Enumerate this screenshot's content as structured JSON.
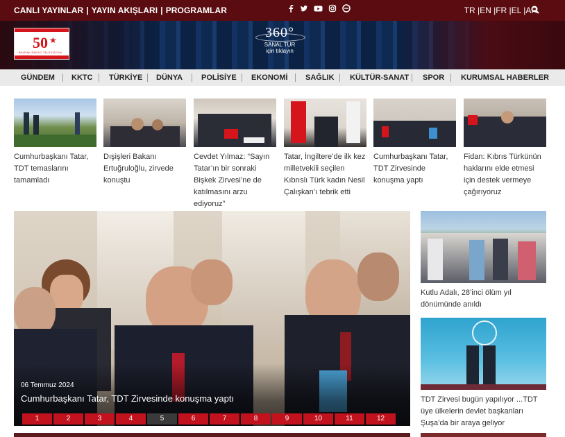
{
  "topbar": {
    "links": [
      "CANLI YAYINLAR",
      "YAYIN AKIŞLARI",
      "PROGRAMLAR"
    ],
    "separator": "|",
    "social_icons": [
      "facebook-icon",
      "twitter-icon",
      "youtube-icon",
      "instagram-icon",
      "edge-icon"
    ],
    "languages": "TR |EN |FR |EL |AR",
    "search_icon": "search-icon"
  },
  "banner": {
    "tour_big": "360°",
    "tour_line1": "SANAL TUR",
    "tour_line2": "için tıklayın"
  },
  "logo": {
    "number": "50",
    "tagline": "BAYRAK RADYO TELEVİZYON KURUMU"
  },
  "nav": {
    "items": [
      "GÜNDEM",
      "KKTC",
      "TÜRKİYE",
      "DÜNYA",
      "POLİSİYE",
      "EKONOMİ",
      "SAĞLIK",
      "KÜLTÜR-SANAT",
      "SPOR",
      "KURUMSAL HABERLER"
    ]
  },
  "news_thumbs": [
    {
      "caption": "Cumhurbaşkanı Tatar, TDT temaslarını tamamladı"
    },
    {
      "caption": "Dışişleri Bakanı Ertuğruloğlu, zirvede konuştu"
    },
    {
      "caption": "Cevdet Yılmaz: “Sayın Tatar’ın bir sonraki Bişkek Zirvesi’ne de katılmasını arzu ediyoruz”"
    },
    {
      "caption": "Tatar, İngiltere’de ilk kez milletvekili seçilen Kıbrıslı Türk kadın Nesil Çalışkan’ı tebrik etti"
    },
    {
      "caption": "Cumhurbaşkanı Tatar, TDT Zirvesinde konuşma yaptı"
    },
    {
      "caption": "Fidan: Kıbrıs Türkünün haklarını elde etmesi için destek vermeye çağırıyoruz"
    }
  ],
  "hero": {
    "date": "06 Temmuz 2024",
    "title": "Cumhurbaşkanı Tatar, TDT Zirvesinde konuşma yaptı",
    "pages": [
      "1",
      "2",
      "3",
      "4",
      "5",
      "6",
      "7",
      "8",
      "9",
      "10",
      "11",
      "12"
    ],
    "active_page": "5"
  },
  "side_news": [
    {
      "caption": "Kutlu Adalı, 28’inci ölüm yıl dönümünde anıldı"
    },
    {
      "caption": "TDT Zirvesi bugün yapılıyor ...TDT üye ülkelerin devlet başkanları Şuşa’da bir araya geliyor"
    }
  ]
}
